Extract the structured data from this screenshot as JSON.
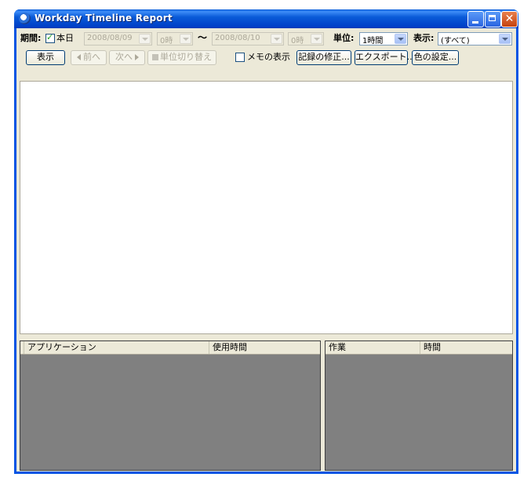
{
  "window": {
    "title": "Workday Timeline Report",
    "close_glyph": "✕"
  },
  "toolbar": {
    "period_label": "期間:",
    "today_label": "本日",
    "today_checked": true,
    "start_date": "2008/08/09",
    "start_hour": "0時",
    "tilde": "〜",
    "end_date": "2008/08/10",
    "end_hour": "0時",
    "unit_label": "単位:",
    "unit_value": "1時間",
    "display_label": "表示:",
    "display_value": "(すべて)",
    "show_button": "表示",
    "prev_button": "前へ",
    "next_button": "次へ",
    "unit_switch_button": "単位切り替え",
    "memo_label": "メモの表示",
    "memo_checked": false,
    "edit_records_button": "記録の修正...",
    "export_button": "エクスポート...",
    "color_settings_button": "色の設定..."
  },
  "app_table": {
    "columns": [
      "アプリケーション",
      "使用時間"
    ]
  },
  "task_table": {
    "columns": [
      "作業",
      "時間"
    ]
  }
}
